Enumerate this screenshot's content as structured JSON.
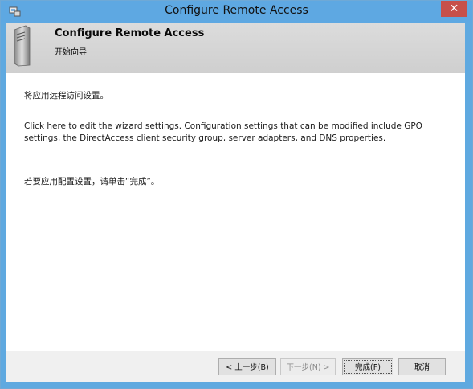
{
  "window": {
    "title": "Configure Remote Access",
    "close_label": "✕"
  },
  "header": {
    "title": "Configure Remote Access",
    "subtitle": "开始向导"
  },
  "content": {
    "intro": "将应用远程访问设置。",
    "details": "Click here to edit the wizard settings. Configuration settings that can be modified include GPO settings, the DirectAccess client security group, server adapters, and DNS properties.",
    "apply_hint": "若要应用配置设置，请单击“完成”。"
  },
  "buttons": {
    "back": "< 上一步(B)",
    "next": "下一步(N) >",
    "finish": "完成(F)",
    "cancel": "取消"
  },
  "colors": {
    "titlebar": "#5ea8e2",
    "close": "#c7504a",
    "header": "#d6d6d6"
  },
  "icons": [
    "app-icon",
    "server-icon",
    "close-icon"
  ]
}
